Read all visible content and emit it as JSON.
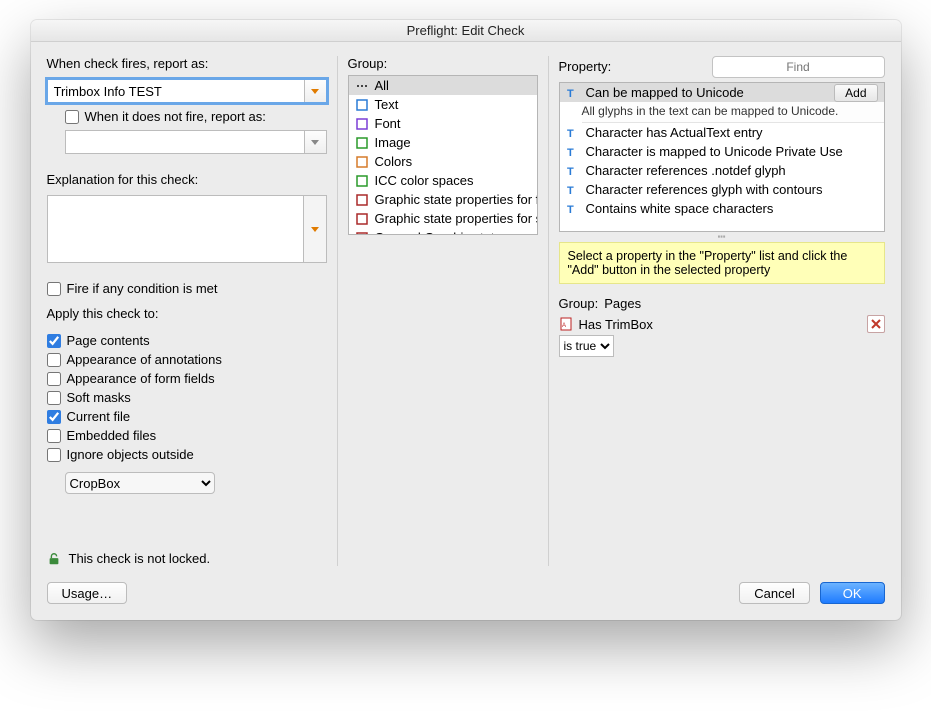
{
  "title": "Preflight: Edit Check",
  "left": {
    "fires_label": "When check fires, report as:",
    "fires_value": "Trimbox Info TEST",
    "notfire_label": "When it does not fire, report as:",
    "explain_label": "Explanation for this check:",
    "fire_any_label": "Fire if any condition is met",
    "apply_label": "Apply this check to:",
    "apply_items": [
      {
        "label": "Page contents",
        "checked": true
      },
      {
        "label": "Appearance of annotations",
        "checked": false
      },
      {
        "label": "Appearance of form fields",
        "checked": false
      },
      {
        "label": "Soft masks",
        "checked": false
      },
      {
        "label": "Current file",
        "checked": true
      },
      {
        "label": "Embedded files",
        "checked": false
      },
      {
        "label": "Ignore objects outside",
        "checked": false
      }
    ],
    "ignore_select": "CropBox",
    "lock_text": "This check is not locked."
  },
  "group": {
    "label": "Group:",
    "items": [
      {
        "icon": "all",
        "label": "All",
        "selected": true
      },
      {
        "icon": "text",
        "label": "Text"
      },
      {
        "icon": "font",
        "label": "Font"
      },
      {
        "icon": "image",
        "label": "Image"
      },
      {
        "icon": "colors",
        "label": "Colors"
      },
      {
        "icon": "icc",
        "label": "ICC color spaces"
      },
      {
        "icon": "gstate",
        "label": "Graphic state properties for fill"
      },
      {
        "icon": "gstate",
        "label": "Graphic state properties for stroke"
      },
      {
        "icon": "gstate",
        "label": "General Graphic state properties"
      }
    ]
  },
  "property": {
    "label": "Property:",
    "find_placeholder": "Find",
    "items": [
      {
        "label": "Can be mapped to Unicode",
        "selected": true,
        "add": true,
        "desc": "All glyphs in the text can be mapped to Unicode."
      },
      {
        "label": "Character has ActualText entry"
      },
      {
        "label": "Character is mapped to Unicode Private Use"
      },
      {
        "label": "Character references .notdef glyph"
      },
      {
        "label": "Character references glyph with contours"
      },
      {
        "label": "Contains white space characters"
      }
    ],
    "add_label": "Add",
    "hint": "Select a property in the \"Property\" list and click the \"Add\" button in the selected property"
  },
  "detail": {
    "group_label": "Group:",
    "group_value": "Pages",
    "prop_value": "Has TrimBox",
    "cond_value": "is true"
  },
  "footer": {
    "usage": "Usage…",
    "cancel": "Cancel",
    "ok": "OK"
  }
}
